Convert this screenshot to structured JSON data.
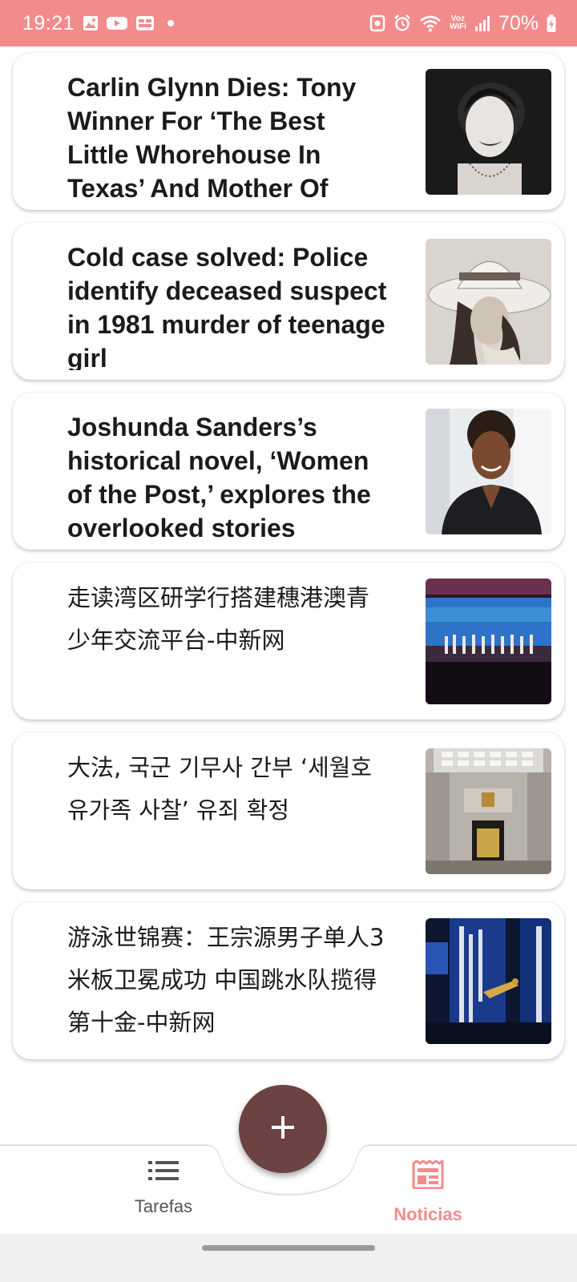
{
  "status_bar": {
    "time": "19:21",
    "voz_label_top": "Voz",
    "voz_label_bottom": "WiFi",
    "battery": "70%"
  },
  "articles": [
    {
      "title": "Carlin Glynn Dies: Tony Winner For ‘The Best Little Whorehouse In Texas’ And Mother Of Mary Stuart Masterson",
      "lang": "en",
      "image": "black-and-white portrait of smiling woman"
    },
    {
      "title": "Cold case solved: Police identify deceased suspect in 1981 murder of teenage girl",
      "lang": "en",
      "image": "sepia photo of young woman in wide-brim hat"
    },
    {
      "title": "Joshunda Sanders’s historical novel, ‘Women of the Post,’ explores the overlooked stories",
      "lang": "en",
      "image": "photo of smiling woman in black blouse"
    },
    {
      "title": "走读湾区研学行搭建穗港澳青少年交流平台-中新网",
      "lang": "zh",
      "image": "stage ceremony with blue screen"
    },
    {
      "title": "大法, 국군 기무사 간부 ‘세월호 유가족 사찰’ 유죄 확정",
      "lang": "ko",
      "image": "grand courtroom interior"
    },
    {
      "title": "游泳世锦赛：王宗源男子单人3米板卫冕成功 中国跳水队揽得第十金-中新网",
      "lang": "zh",
      "image": "diver in front of blue championship banner"
    }
  ],
  "nav": {
    "tasks_label": "Tarefas",
    "news_label": "Noticias",
    "active": "news"
  },
  "fab": {
    "icon": "plus-icon"
  },
  "colors": {
    "accent": "#f28b8c",
    "fab": "#6d4242",
    "text": "#1b1b1b",
    "nav_inactive": "#555555"
  }
}
